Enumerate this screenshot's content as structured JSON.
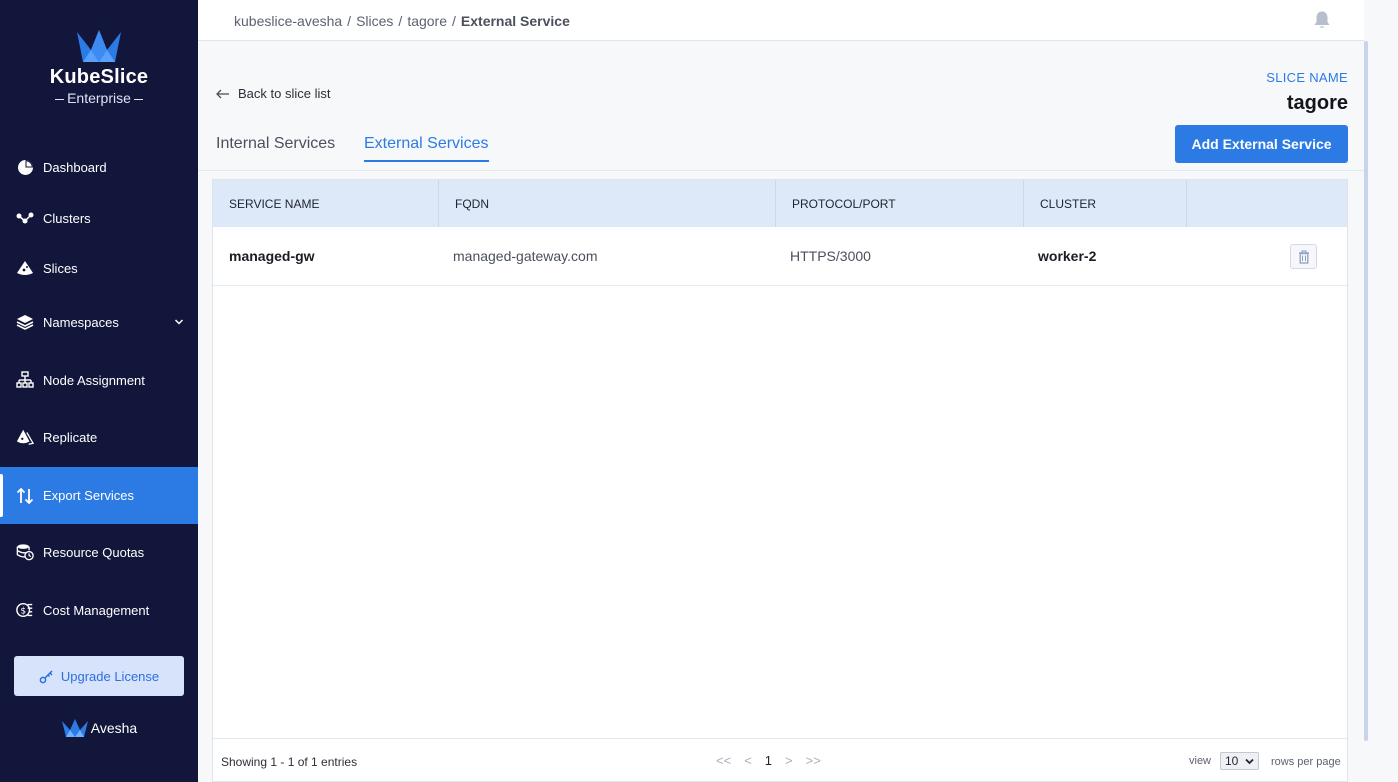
{
  "brand": {
    "name": "KubeSlice",
    "edition": "Enterprise",
    "company": "Avesha"
  },
  "sidebar": {
    "items": [
      {
        "label": "Dashboard",
        "icon": "pie-chart-icon"
      },
      {
        "label": "Clusters",
        "icon": "cluster-nodes-icon"
      },
      {
        "label": "Slices",
        "icon": "slice-icon"
      },
      {
        "label": "Namespaces",
        "icon": "layers-icon"
      },
      {
        "label": "Node Assignment",
        "icon": "hierarchy-icon"
      },
      {
        "label": "Replicate",
        "icon": "replicate-icon"
      },
      {
        "label": "Export Services",
        "icon": "arrows-up-down-icon"
      },
      {
        "label": "Resource Quotas",
        "icon": "quota-icon"
      },
      {
        "label": "Cost Management",
        "icon": "coins-icon"
      }
    ],
    "active_item": "Export Services",
    "upgrade_label": "Upgrade License"
  },
  "breadcrumb": {
    "items": [
      "kubeslice-avesha",
      "Slices",
      "tagore"
    ],
    "separator": "/",
    "current": "External Service"
  },
  "header": {
    "back_label": "Back to slice list",
    "slice_name_label": "SLICE NAME",
    "slice_name": "tagore",
    "tabs": [
      {
        "label": "Internal Services",
        "active": false
      },
      {
        "label": "External Services",
        "active": true
      }
    ],
    "add_button_label": "Add External Service"
  },
  "table": {
    "columns": [
      "SERVICE NAME",
      "FQDN",
      "PROTOCOL/PORT",
      "CLUSTER",
      ""
    ],
    "rows": [
      {
        "service_name": "managed-gw",
        "fqdn": "managed-gateway.com",
        "protocol_port": "HTTPS/3000",
        "cluster": "worker-2"
      }
    ]
  },
  "pagination": {
    "showing": "Showing 1 - 1 of 1 entries",
    "first": "<<",
    "prev": "<",
    "page": "1",
    "next": ">",
    "last": ">>",
    "view_label": "view",
    "rows_per_page": "10",
    "rows_per_page_label": "rows per page"
  },
  "colors": {
    "sidebar_bg": "#12163a",
    "accent": "#2c7be5",
    "table_header_bg": "#dde8f9"
  }
}
